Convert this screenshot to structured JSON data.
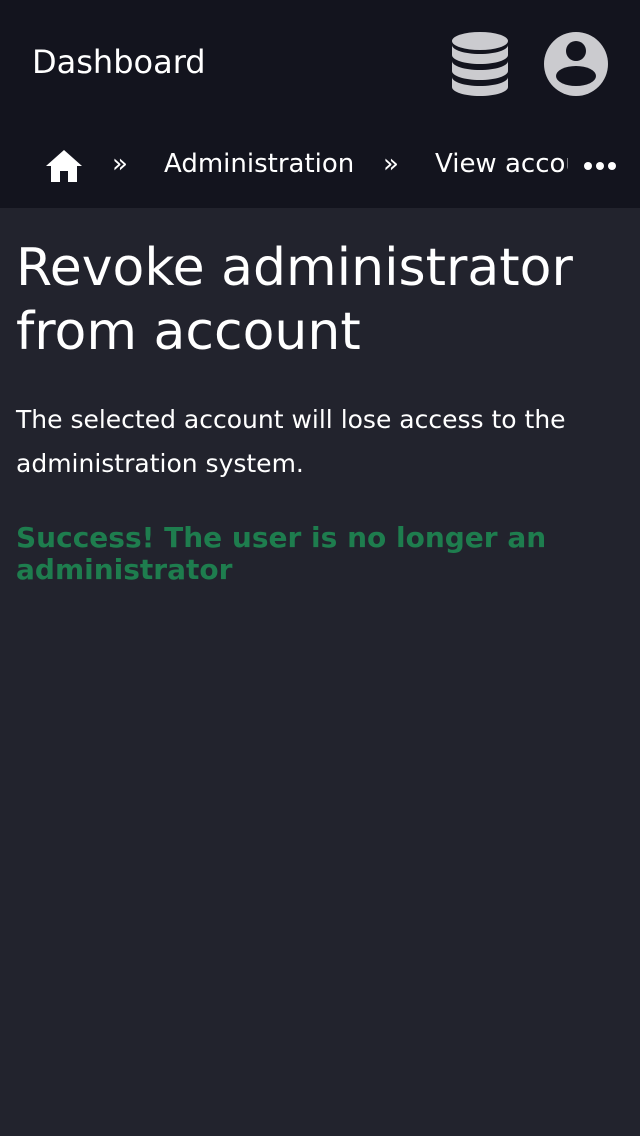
{
  "header": {
    "title": "Dashboard",
    "database_icon": "database-icon",
    "account_icon": "user-circle-icon"
  },
  "breadcrumb": {
    "home_icon": "home-icon",
    "separator": "»",
    "items": [
      {
        "label": "Administration"
      },
      {
        "label": "View account"
      }
    ],
    "more_icon": "ellipsis-icon"
  },
  "page": {
    "title": "Revoke administrator from account",
    "description": "The selected account will lose access to the administration system.",
    "success_message": "Success! The user is no longer an administrator"
  },
  "colors": {
    "header_bg": "#13141e",
    "page_bg": "#22232d",
    "icon_gray": "#cbcbcf",
    "success": "#1e7d4e"
  }
}
